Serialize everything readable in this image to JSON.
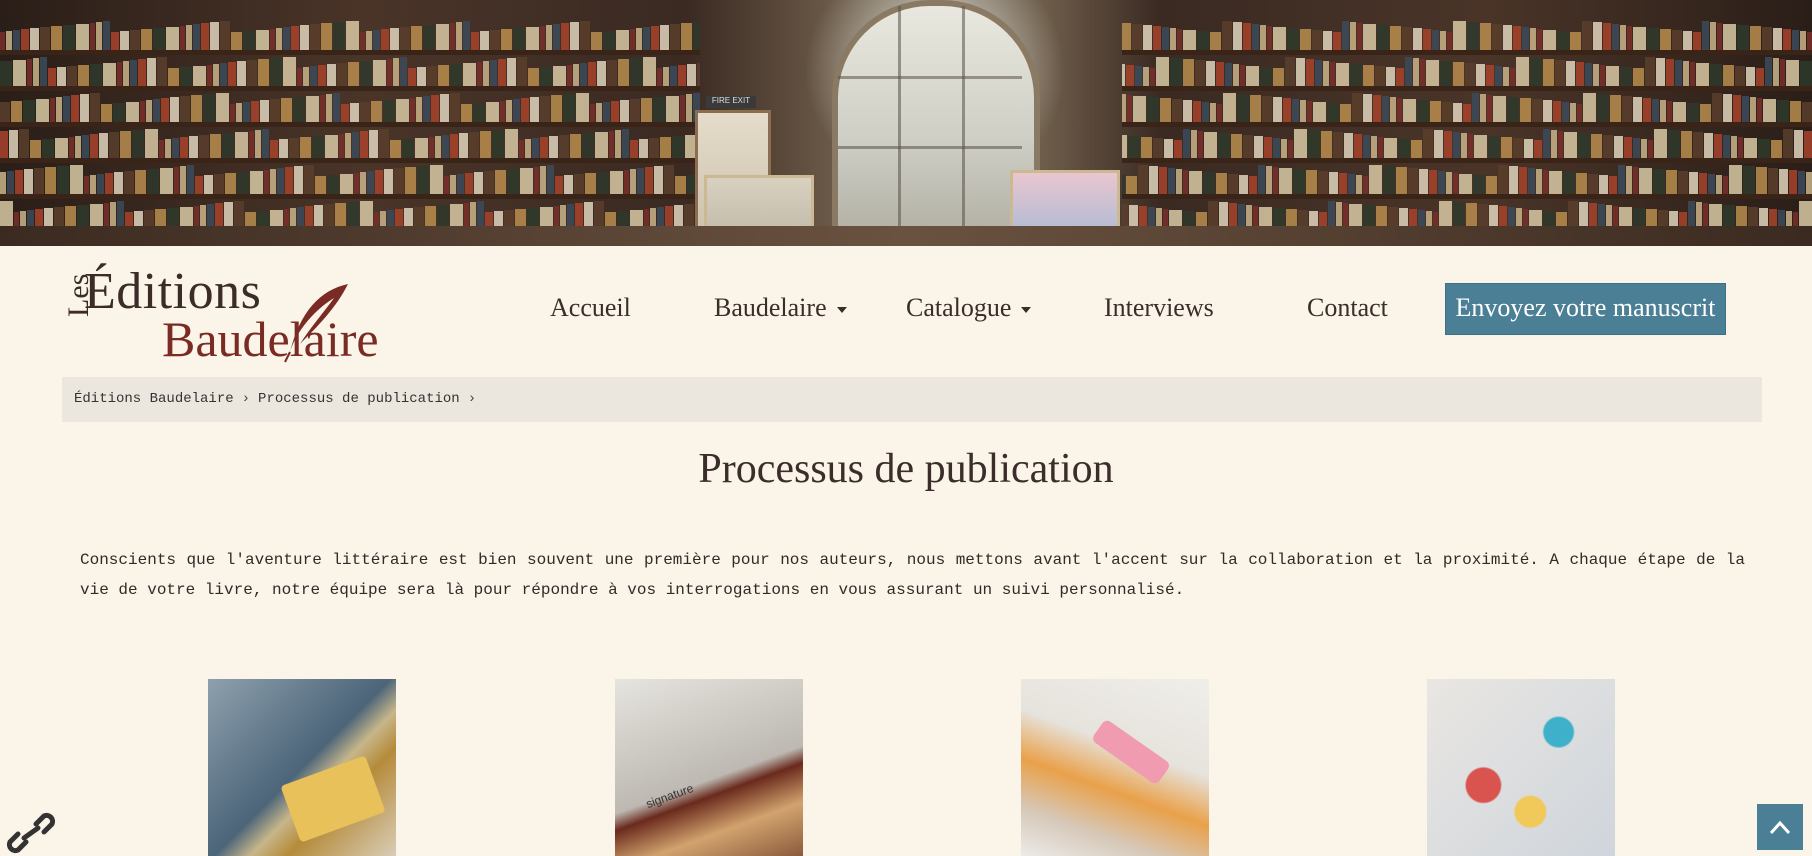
{
  "banner": {
    "alt": "Library bookshelves",
    "exit_sign": "FIRE EXIT"
  },
  "logo": {
    "les": "Les",
    "editions": "Éditions",
    "baudelaire": "Baudelaire"
  },
  "nav": {
    "items": [
      {
        "label": "Accueil",
        "dropdown": false
      },
      {
        "label": "Baudelaire",
        "dropdown": true
      },
      {
        "label": "Catalogue",
        "dropdown": true
      },
      {
        "label": "Interviews",
        "dropdown": false
      },
      {
        "label": "Contact",
        "dropdown": false
      }
    ],
    "cta": "Envoyez votre manuscrit"
  },
  "breadcrumb": {
    "items": [
      "Éditions Baudelaire",
      "Processus de publication"
    ],
    "separator": "›"
  },
  "main": {
    "title": "Processus de publication",
    "intro": "Conscients que l'aventure littéraire est bien souvent une première pour nos auteurs, nous mettons avant l'accent sur la collaboration et la proximité. A chaque étape de la vie de votre livre, notre équipe sera là pour répondre à vos interrogations en vous assurant un suivi personnalisé.",
    "thumbnails": [
      {
        "name": "reading-thumbnail"
      },
      {
        "name": "signature-thumbnail",
        "text": "signature"
      },
      {
        "name": "correction-thumbnail"
      },
      {
        "name": "design-thumbnail"
      }
    ]
  },
  "colors": {
    "accent": "#4b7f95",
    "background": "#faf5e8",
    "logo_red": "#7a2b24",
    "text": "#3a2d2a"
  },
  "icons": {
    "link": "link-icon",
    "scroll_top": "chevron-up-icon"
  }
}
